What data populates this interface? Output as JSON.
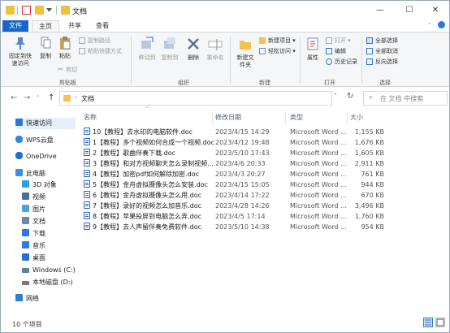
{
  "window": {
    "title": "文档",
    "minimize": "—",
    "maximize": "☐",
    "close": "✕"
  },
  "ribbon_tabs": [
    {
      "label": "文件"
    },
    {
      "label": "主页"
    },
    {
      "label": "共享"
    },
    {
      "label": "查看"
    }
  ],
  "ribbon": {
    "clipboard": {
      "pin_quick": "固定到快速访问",
      "copy": "复制",
      "paste": "粘贴",
      "copy_path": "复制路径",
      "paste_shortcut": "粘贴快捷方式",
      "cut": "剪切",
      "group": "剪贴板"
    },
    "organize": {
      "move_to": "移动到",
      "copy_to": "复制到",
      "delete": "删除",
      "rename": "重命名",
      "group": "组织"
    },
    "new": {
      "new_folder": "新建文件夹",
      "new_item": "新建项目",
      "easy_access": "轻松访问",
      "group": "新建"
    },
    "open": {
      "properties": "属性",
      "open": "打开",
      "edit": "编辑",
      "history": "历史记录",
      "group": "打开"
    },
    "select": {
      "select_all": "全部选择",
      "select_none": "全部取消",
      "invert": "反向选择",
      "group": "选择"
    }
  },
  "address": {
    "path": "文档",
    "search_placeholder": "在 文档 中搜索"
  },
  "sidebar": [
    {
      "label": "快速访问",
      "icon": "star-icon",
      "color": "#2a78d6"
    },
    {
      "label": "WPS云盘",
      "icon": "cloud-icon",
      "color": "#2f86e8"
    },
    {
      "label": "OneDrive",
      "icon": "onedrive-icon",
      "color": "#1c6fd1"
    },
    {
      "label": "此电脑",
      "icon": "computer-icon",
      "color": "#3b8ee0"
    },
    {
      "label": "3D 对象",
      "icon": "cube-icon",
      "color": "#2da0e6"
    },
    {
      "label": "视频",
      "icon": "video-icon",
      "color": "#4a6fa5"
    },
    {
      "label": "图片",
      "icon": "picture-icon",
      "color": "#4aa3df"
    },
    {
      "label": "文档",
      "icon": "document-icon",
      "color": "#6f88a8"
    },
    {
      "label": "下载",
      "icon": "download-icon",
      "color": "#2b7bd6"
    },
    {
      "label": "音乐",
      "icon": "music-icon",
      "color": "#2f7fd8"
    },
    {
      "label": "桌面",
      "icon": "desktop-icon",
      "color": "#2a6ed1"
    },
    {
      "label": "Windows (C:)",
      "icon": "drive-icon",
      "color": "#5a7fa8"
    },
    {
      "label": "本地磁盘 (D:)",
      "icon": "drive-icon",
      "color": "#777777"
    },
    {
      "label": "网络",
      "icon": "network-icon",
      "color": "#2f7fd8"
    }
  ],
  "columns": {
    "name": "名称",
    "date": "修改日期",
    "type": "类型",
    "size": "大小"
  },
  "files": [
    {
      "name": "10【教程】去水印的电脑软件.doc",
      "date": "2023/4/15 14:29",
      "type": "Microsoft Word ...",
      "size": "1,155 KB"
    },
    {
      "name": "1【教程】多个视频如何合成一个视频.doc",
      "date": "2023/4/12 19:48",
      "type": "Microsoft Word ...",
      "size": "1,676 KB"
    },
    {
      "name": "2【教程】歌曲伴奏下载.doc",
      "date": "2023/5/10 17:43",
      "type": "Microsoft Word ...",
      "size": "1,605 KB"
    },
    {
      "name": "3【教程】和对方视频聊天怎么录制视频....",
      "date": "2023/4/6 20:33",
      "type": "Microsoft Word ...",
      "size": "2,911 KB"
    },
    {
      "name": "4【教程】加密pdf如何解除加密.doc",
      "date": "2023/4/3 20:27",
      "type": "Microsoft Word ...",
      "size": "761 KB"
    },
    {
      "name": "5【教程】金舟虚拟摄像头怎么安装.doc",
      "date": "2023/4/15 15:05",
      "type": "Microsoft Word ...",
      "size": "944 KB"
    },
    {
      "name": "6【教程】金舟虚拟摄像头怎么用.doc",
      "date": "2023/4/14 17:22",
      "type": "Microsoft Word ...",
      "size": "670 KB"
    },
    {
      "name": "7【教程】录好的视频怎么加音乐.doc",
      "date": "2023/4/28 14:26",
      "type": "Microsoft Word ...",
      "size": "3,496 KB"
    },
    {
      "name": "8【教程】苹果投屏到电脑怎么弄.doc",
      "date": "2023/4/5 17:14",
      "type": "Microsoft Word ...",
      "size": "1,760 KB"
    },
    {
      "name": "9【教程】去人声留伴奏免费软件.doc",
      "date": "2023/5/10 14:38",
      "type": "Microsoft Word ...",
      "size": "954 KB"
    }
  ],
  "status": {
    "count": "10 个项目"
  }
}
